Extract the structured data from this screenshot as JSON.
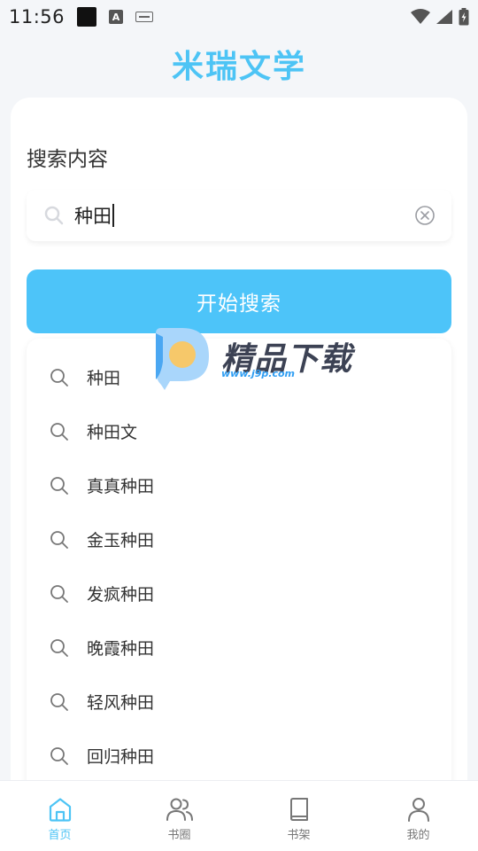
{
  "status_bar": {
    "time": "11:56",
    "a_badge": "A"
  },
  "app": {
    "title": "米瑞文学"
  },
  "search": {
    "label": "搜索内容",
    "value": "种田",
    "start_button": "开始搜索"
  },
  "suggestions": [
    "种田",
    "种田文",
    "真真种田",
    "金玉种田",
    "发疯种田",
    "晚霞种田",
    "轻风种田",
    "回归种田"
  ],
  "watermark": {
    "text": "精品下载",
    "url": "www.j9p.com"
  },
  "nav": [
    {
      "label": "首页",
      "icon": "home-icon",
      "active": true
    },
    {
      "label": "书圈",
      "icon": "users-icon",
      "active": false
    },
    {
      "label": "书架",
      "icon": "book-icon",
      "active": false
    },
    {
      "label": "我的",
      "icon": "user-icon",
      "active": false
    }
  ],
  "colors": {
    "accent": "#4dc4f5",
    "button": "#4dc4f9",
    "background": "#f4f6f9"
  }
}
